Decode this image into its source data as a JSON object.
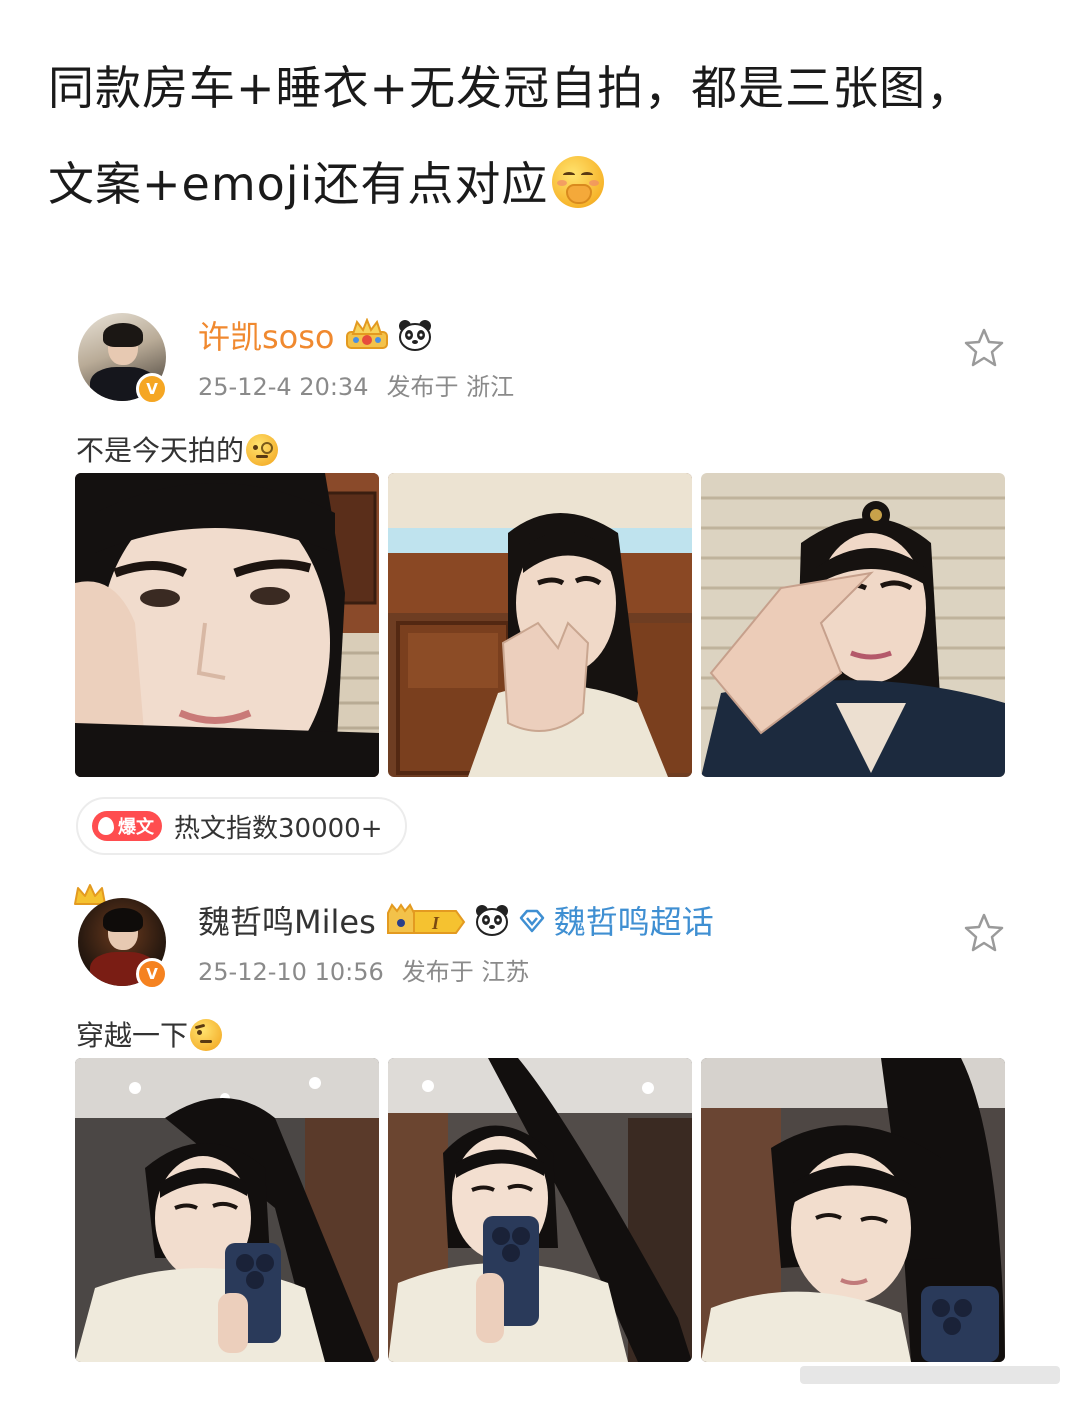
{
  "headline": {
    "line1": "同款房车+睡衣+无发冠自拍，都是三张图，",
    "line2": "文案+emoji还有点对应",
    "emoji": "hand-over-mouth-emoji"
  },
  "posts": [
    {
      "username": "许凯soso",
      "timestamp": "25-12-4 20:34",
      "location": "发布于 浙江",
      "caption": "不是今天拍的",
      "caption_emoji": "monocle-face-emoji",
      "photos": [
        "selfie-photo-1",
        "selfie-photo-2",
        "selfie-photo-3"
      ],
      "hot": {
        "tag": "爆文",
        "text": "热文指数30000+"
      }
    },
    {
      "username": "魏哲鸣Miles",
      "supertopic": "魏哲鸣超话",
      "level_badge": "I",
      "timestamp": "25-12-10 10:56",
      "location": "发布于 江苏",
      "caption": "穿越一下",
      "caption_emoji": "raised-eyebrow-emoji",
      "photos": [
        "selfie-photo-1",
        "selfie-photo-2",
        "selfie-photo-3"
      ]
    }
  ],
  "colors": {
    "username_vip": "#f0892f",
    "supertopic": "#3f8fd2",
    "meta_text": "#8a8a8a",
    "hot_tag": "#ff4d4f"
  }
}
